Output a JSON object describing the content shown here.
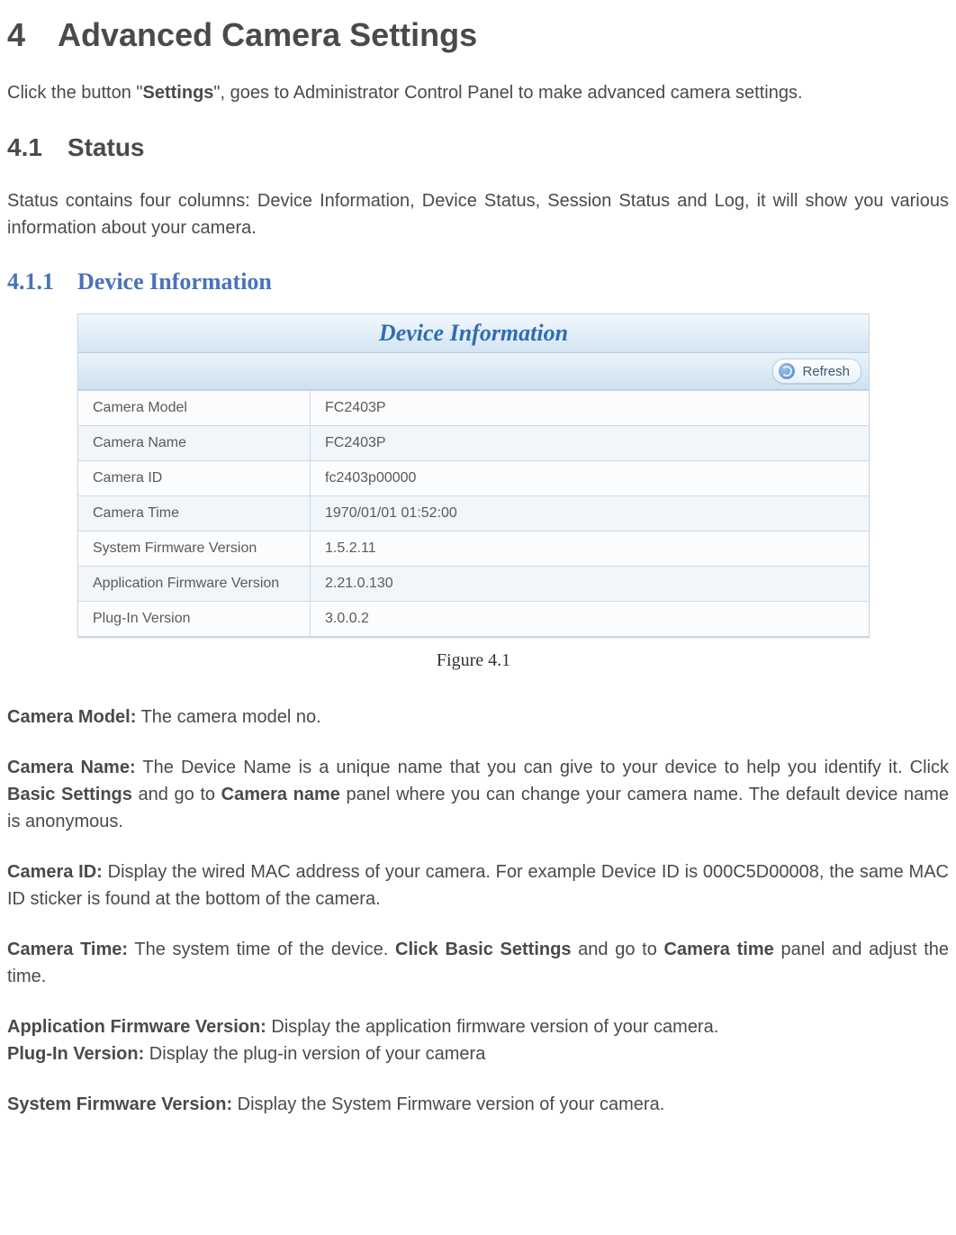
{
  "headings": {
    "chapter": "4 Advanced Camera Settings",
    "section_4_1": "4.1 Status",
    "subsection_4_1_1": "4.1.1 Device Information"
  },
  "intro": {
    "pre": "Click the button \"",
    "settings_bold": "Settings",
    "post": "\", goes to Administrator Control Panel to make advanced camera settings."
  },
  "status_intro": "Status contains four columns: Device Information, Device Status, Session Status and Log, it will show you various information about your camera.",
  "panel": {
    "title": "Device Information",
    "refresh_label": "Refresh",
    "rows": [
      {
        "label": "Camera Model",
        "value": "FC2403P"
      },
      {
        "label": "Camera Name",
        "value": "FC2403P"
      },
      {
        "label": "Camera ID",
        "value": "fc2403p00000"
      },
      {
        "label": "Camera Time",
        "value": "1970/01/01 01:52:00"
      },
      {
        "label": "System Firmware Version",
        "value": "1.5.2.11"
      },
      {
        "label": "Application Firmware Version",
        "value": "2.21.0.130"
      },
      {
        "label": "Plug-In Version",
        "value": "3.0.0.2"
      }
    ]
  },
  "figure_caption": "Figure 4.1",
  "descriptions": {
    "camera_model": {
      "lead": "Camera Model:",
      "text": " The camera model no."
    },
    "camera_name": {
      "lead": "Camera Name:",
      "seg1": " The Device Name is a unique name that you can give to your device to help you identify it. Click ",
      "bold1": "Basic Settings",
      "seg2": " and go to ",
      "bold2": "Camera name",
      "seg3": " panel where you can change your camera name. The default device name is anonymous."
    },
    "camera_id": {
      "lead": "Camera ID:",
      "text": " Display the wired MAC address of your camera. For example Device ID is 000C5D00008, the same MAC ID sticker is found at the bottom of the camera."
    },
    "camera_time": {
      "lead": "Camera Time:",
      "seg1": " The system time of the device. ",
      "bold1": "Click Basic Settings",
      "seg2": " and go to ",
      "bold2": "Camera time",
      "seg3": " panel and adjust the time."
    },
    "app_fw": {
      "lead": "Application Firmware Version:",
      "text": " Display the application firmware version of your camera."
    },
    "plugin": {
      "lead": "Plug-In Version:",
      "text": " Display the plug-in version of your camera"
    },
    "sys_fw": {
      "lead": "System Firmware Version:",
      "text": " Display the System Firmware version of your camera."
    }
  }
}
